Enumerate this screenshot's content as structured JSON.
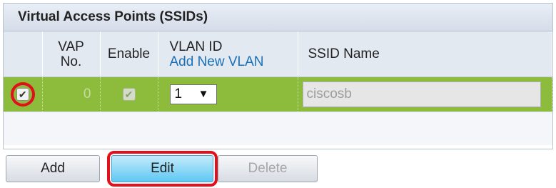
{
  "panel": {
    "title": "Virtual Access Points (SSIDs)"
  },
  "columns": {
    "vap_no": "VAP\nNo.",
    "enable": "Enable",
    "vlan_id": "VLAN ID",
    "add_new_vlan": "Add New VLAN",
    "ssid_name": "SSID Name"
  },
  "row": {
    "selected": true,
    "vap_no": "0",
    "enabled": true,
    "vlan_value": "1",
    "ssid_value": "ciscosb"
  },
  "buttons": {
    "add": "Add",
    "edit": "Edit",
    "delete": "Delete"
  },
  "colors": {
    "row_selected": "#8dbb3c",
    "highlight": "#e2101a",
    "link": "#1b6fb5"
  },
  "icons": {
    "checkmark": "check-icon",
    "dropdown": "triangle-down-icon"
  }
}
